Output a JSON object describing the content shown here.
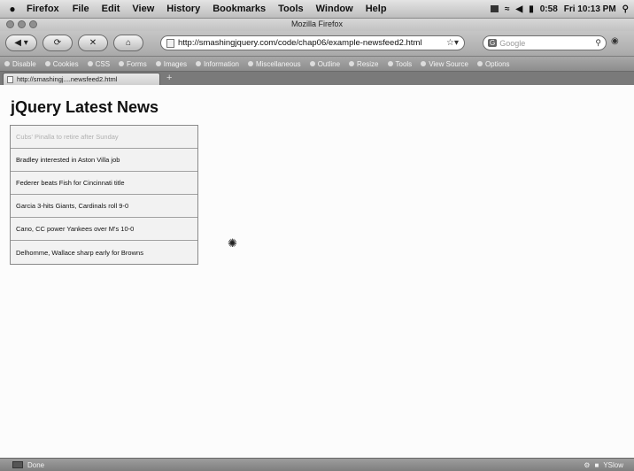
{
  "menubar": {
    "app_name": "Firefox",
    "items": [
      "File",
      "Edit",
      "View",
      "History",
      "Bookmarks",
      "Tools",
      "Window",
      "Help"
    ],
    "battery": "0:58",
    "clock": "Fri 10:13 PM"
  },
  "window": {
    "title": "Mozilla Firefox"
  },
  "toolbar": {
    "url": "http://smashingjquery.com/code/chap06/example-newsfeed2.html",
    "search_placeholder": "Google"
  },
  "devbar": {
    "items": [
      "Disable",
      "Cookies",
      "CSS",
      "Forms",
      "Images",
      "Information",
      "Miscellaneous",
      "Outline",
      "Resize",
      "Tools",
      "View Source",
      "Options"
    ]
  },
  "tab": {
    "title": "http://smashingj....newsfeed2.html"
  },
  "page": {
    "title": "jQuery Latest News",
    "news": [
      "Cubs' Pinalla to retire after Sunday",
      "Bradley interested in Aston Villa job",
      "Federer beats Fish for Cincinnati title",
      "Garcia 3-hits Giants, Cardinals roll 9-0",
      "Cano, CC power Yankees over M's 10-0",
      "Delhomme, Wallace sharp early for Browns"
    ]
  },
  "status": {
    "text": "Done",
    "yslow": "YSlow"
  }
}
